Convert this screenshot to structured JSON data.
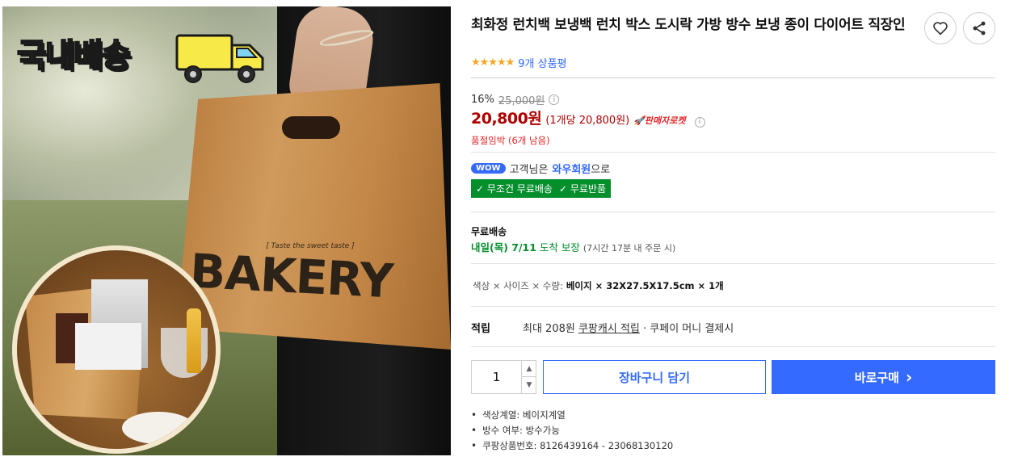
{
  "image": {
    "badge_text": "국내배송",
    "bag_tagline": "[ Taste the sweet taste ]",
    "bag_text": "BAKERY"
  },
  "product": {
    "title": "최화정 런치백 보냉백 런치 박스 도시락 가방 방수 보냉 종이 다이어트 직장인",
    "stars": "★★★★★",
    "review_count": "9개 상품평",
    "discount_rate": "16%",
    "original_price": "25,000원",
    "price": "20,800원",
    "unit_price": "(1개당 20,800원)",
    "seller_badge": "🚀판매자로켓",
    "stock_notice": "품절임박 (6개 남음)"
  },
  "membership": {
    "wow_badge": "WOW",
    "text_before": "고객님은",
    "member_link": "와우회원",
    "text_after": "으로",
    "benefit_free_ship": "✓ 무조건 무료배송",
    "benefit_free_return": "✓ 무료반품"
  },
  "shipping": {
    "label": "무료배송",
    "date": "내일(목) 7/11",
    "guarantee": "도착 보장",
    "cutoff": "(7시간 17분 내 주문 시)"
  },
  "options": {
    "label": "색상 × 사이즈 × 수량:",
    "value": "베이지 × 32X27.5X17.5cm × 1개"
  },
  "points": {
    "label": "적립",
    "text_before": "최대 208원",
    "cash_link": "쿠팡캐시 적립",
    "text_after": "· 쿠페이 머니 결제시"
  },
  "purchase": {
    "quantity": "1",
    "qty_up": "▲",
    "qty_down": "▼",
    "cart_button": "장바구니 담기",
    "buy_button": "바로구매",
    "buy_chevron": "›"
  },
  "specs": [
    "색상계열: 베이지계열",
    "방수 여부: 방수가능",
    "쿠팡상품번호: 8126439164 - 23068130120"
  ],
  "colors": {
    "accent_blue": "#346aff",
    "price_red": "#ae0000",
    "alert_red": "#e52528",
    "wow_green": "#058e2c"
  },
  "icons": [
    "heart-icon",
    "share-icon",
    "info-icon",
    "delivery-truck-icon"
  ]
}
